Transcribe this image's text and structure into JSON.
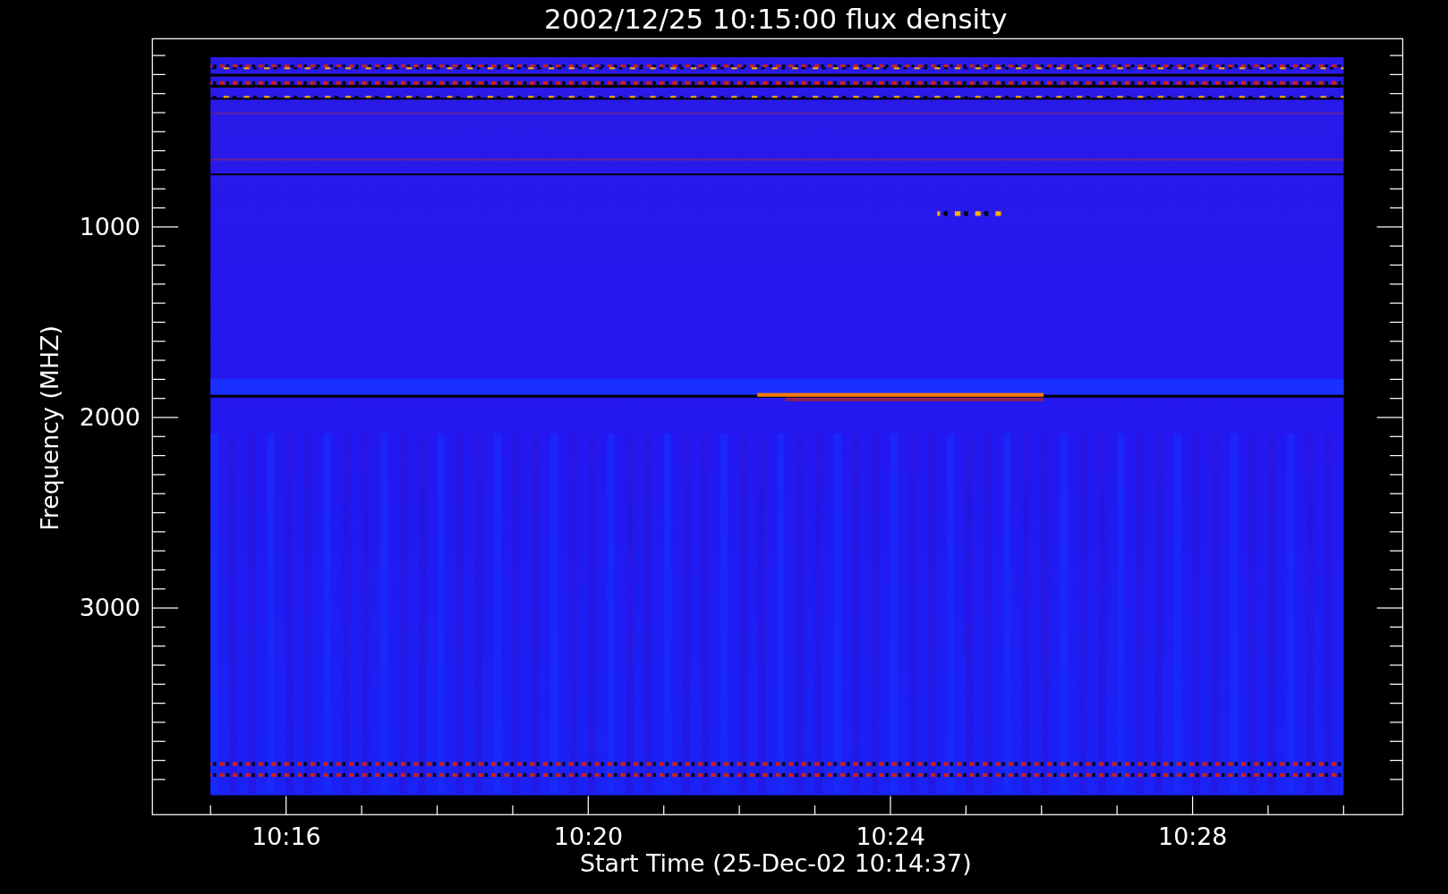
{
  "title": "2002/12/25 10:15:00 flux density",
  "ylabel": "Frequency (MHZ)",
  "xlabel": "Start Time (25-Dec-02 10:14:37)",
  "yticks": [
    "1000",
    "2000",
    "3000"
  ],
  "xticks": [
    "10:16",
    "10:20",
    "10:24",
    "10:28"
  ]
}
